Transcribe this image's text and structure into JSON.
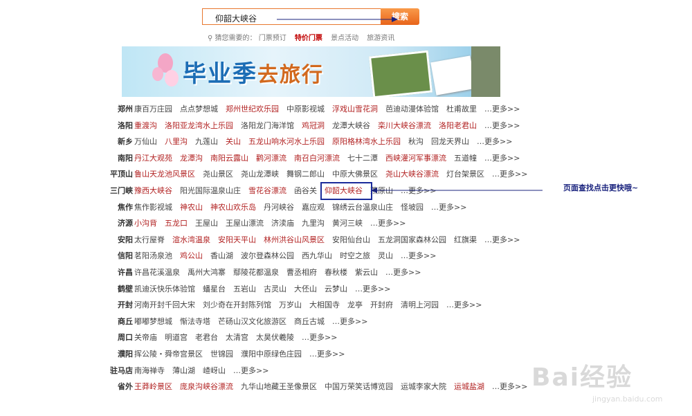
{
  "search": {
    "value": "仰韶大峡谷",
    "button_label": "搜索"
  },
  "hints": {
    "label": "猜您需要的：",
    "items": [
      "门票预订",
      "特价门票",
      "景点活动",
      "旅游资讯"
    ]
  },
  "banner": {
    "title": "毕业季",
    "subtitle": "去旅行"
  },
  "rows": [
    {
      "city": "郑州",
      "links": [
        {
          "t": "康百万庄园",
          "h": false
        },
        {
          "t": "点点梦想城",
          "h": false
        },
        {
          "t": "郑州世纪欢乐园",
          "h": true
        },
        {
          "t": "中原影视城",
          "h": false
        },
        {
          "t": "浮戏山雪花洞",
          "h": true
        },
        {
          "t": "芭迪动漫体验馆",
          "h": false
        },
        {
          "t": "杜甫故里",
          "h": false
        },
        {
          "t": "…更多>>",
          "h": false
        }
      ]
    },
    {
      "city": "洛阳",
      "links": [
        {
          "t": "重渡沟",
          "h": true
        },
        {
          "t": "洛阳亚龙湾水上乐园",
          "h": true
        },
        {
          "t": "洛阳龙门海洋馆",
          "h": false
        },
        {
          "t": "鸡冠洞",
          "h": true
        },
        {
          "t": "龙潭大峡谷",
          "h": false
        },
        {
          "t": "栾川大峡谷漂流",
          "h": true
        },
        {
          "t": "洛阳老君山",
          "h": true
        },
        {
          "t": "…更多>>",
          "h": false
        }
      ]
    },
    {
      "city": "新乡",
      "links": [
        {
          "t": "万仙山",
          "h": false
        },
        {
          "t": "八里沟",
          "h": true
        },
        {
          "t": "九莲山",
          "h": false
        },
        {
          "t": "关山",
          "h": true
        },
        {
          "t": "五龙山响水河水上乐园",
          "h": true
        },
        {
          "t": "原阳格林湾水上乐园",
          "h": true
        },
        {
          "t": "秋沟",
          "h": false
        },
        {
          "t": "回龙天界山",
          "h": false
        },
        {
          "t": "…更多>>",
          "h": false
        }
      ]
    },
    {
      "city": "南阳",
      "links": [
        {
          "t": "丹江大观苑",
          "h": true
        },
        {
          "t": "龙潭沟",
          "h": true
        },
        {
          "t": "南阳云露山",
          "h": true
        },
        {
          "t": "鹳河漂流",
          "h": true
        },
        {
          "t": "南召白河漂流",
          "h": true
        },
        {
          "t": "七十二潭",
          "h": false
        },
        {
          "t": "西峡灌河军事漂流",
          "h": true
        },
        {
          "t": "五道幢",
          "h": false
        },
        {
          "t": "…更多>>",
          "h": false
        }
      ]
    },
    {
      "city": "平顶山",
      "links": [
        {
          "t": "鲁山天龙池风景区",
          "h": true
        },
        {
          "t": "尧山景区",
          "h": false
        },
        {
          "t": "尧山龙潭峡",
          "h": false
        },
        {
          "t": "舞钢二郎山",
          "h": false
        },
        {
          "t": "中原大佛景区",
          "h": false
        },
        {
          "t": "尧山大峡谷漂流",
          "h": true
        },
        {
          "t": "灯台架景区",
          "h": false
        },
        {
          "t": "…更多>>",
          "h": false
        }
      ]
    },
    {
      "city": "三门峡",
      "links": [
        {
          "t": "豫西大峡谷",
          "h": true
        },
        {
          "t": "阳光国际温泉山庄",
          "h": false
        },
        {
          "t": "雪花谷漂流",
          "h": true
        },
        {
          "t": "函谷关",
          "h": false
        },
        {
          "t": "仰韶大峡谷",
          "h": true
        },
        {
          "t": "燕原山",
          "h": false
        },
        {
          "t": "…更多>>",
          "h": false
        }
      ]
    },
    {
      "city": "焦作",
      "links": [
        {
          "t": "焦作影视城",
          "h": false
        },
        {
          "t": "神农山",
          "h": true
        },
        {
          "t": "神农山欢乐岛",
          "h": true
        },
        {
          "t": "丹河峡谷",
          "h": false
        },
        {
          "t": "嘉应观",
          "h": false
        },
        {
          "t": "锦绣云台温泉山庄",
          "h": false
        },
        {
          "t": "怪坡园",
          "h": false
        },
        {
          "t": "…更多>>",
          "h": false
        }
      ]
    },
    {
      "city": "济源",
      "links": [
        {
          "t": "小沟背",
          "h": true
        },
        {
          "t": "五龙口",
          "h": true
        },
        {
          "t": "王屋山",
          "h": false
        },
        {
          "t": "王屋山漂流",
          "h": false
        },
        {
          "t": "济渎庙",
          "h": false
        },
        {
          "t": "九里沟",
          "h": false
        },
        {
          "t": "黄河三峡",
          "h": false
        },
        {
          "t": "…更多>>",
          "h": false
        }
      ]
    },
    {
      "city": "安阳",
      "links": [
        {
          "t": "太行屋脊",
          "h": false
        },
        {
          "t": "渲水湾温泉",
          "h": true
        },
        {
          "t": "安阳天平山",
          "h": true
        },
        {
          "t": "林州洪谷山风景区",
          "h": true
        },
        {
          "t": "安阳仙台山",
          "h": false
        },
        {
          "t": "五龙洞国家森林公园",
          "h": false
        },
        {
          "t": "红旗渠",
          "h": false
        },
        {
          "t": "…更多>>",
          "h": false
        }
      ]
    },
    {
      "city": "信阳",
      "links": [
        {
          "t": "茗阳汤泉池",
          "h": false
        },
        {
          "t": "鸡公山",
          "h": true
        },
        {
          "t": "香山湖",
          "h": false
        },
        {
          "t": "波尔登森林公园",
          "h": false
        },
        {
          "t": "西九华山",
          "h": false
        },
        {
          "t": "时空之旅",
          "h": false
        },
        {
          "t": "灵山",
          "h": false
        },
        {
          "t": "…更多>>",
          "h": false
        }
      ]
    },
    {
      "city": "许昌",
      "links": [
        {
          "t": "许昌花溪温泉",
          "h": false
        },
        {
          "t": "禹州大鸿寨",
          "h": false
        },
        {
          "t": "鄢陵花都温泉",
          "h": false
        },
        {
          "t": "曹丞相府",
          "h": false
        },
        {
          "t": "春秋楼",
          "h": false
        },
        {
          "t": "紫云山",
          "h": false
        },
        {
          "t": "…更多>>",
          "h": false
        }
      ]
    },
    {
      "city": "鹤壁",
      "links": [
        {
          "t": "凯迪沃快乐体验馆",
          "h": false
        },
        {
          "t": "蟠星台",
          "h": false
        },
        {
          "t": "五岩山",
          "h": false
        },
        {
          "t": "古灵山",
          "h": false
        },
        {
          "t": "大伾山",
          "h": false
        },
        {
          "t": "云梦山",
          "h": false
        },
        {
          "t": "…更多>>",
          "h": false
        }
      ]
    },
    {
      "city": "开封",
      "links": [
        {
          "t": "河南开封千回大宋",
          "h": false
        },
        {
          "t": "刘少奇在开封陈列馆",
          "h": false
        },
        {
          "t": "万岁山",
          "h": false
        },
        {
          "t": "大相国寺",
          "h": false
        },
        {
          "t": "龙亭",
          "h": false
        },
        {
          "t": "开封府",
          "h": false
        },
        {
          "t": "清明上河园",
          "h": false
        },
        {
          "t": "…更多>>",
          "h": false
        }
      ]
    },
    {
      "city": "商丘",
      "links": [
        {
          "t": "嘟嘟梦想城",
          "h": false
        },
        {
          "t": "惭法寺塔",
          "h": false
        },
        {
          "t": "芒砀山汉文化旅游区",
          "h": false
        },
        {
          "t": "商丘古城",
          "h": false
        },
        {
          "t": "…更多>>",
          "h": false
        }
      ]
    },
    {
      "city": "周口",
      "links": [
        {
          "t": "关帝庙",
          "h": false
        },
        {
          "t": "明道宫",
          "h": false
        },
        {
          "t": "老君台",
          "h": false
        },
        {
          "t": "太清宫",
          "h": false
        },
        {
          "t": "太昊伏羲陵",
          "h": false
        },
        {
          "t": "…更多>>",
          "h": false
        }
      ]
    },
    {
      "city": "濮阳",
      "links": [
        {
          "t": "挥公陵・舜帝宫景区",
          "h": false
        },
        {
          "t": "世锦园",
          "h": false
        },
        {
          "t": "濮阳中原绿色庄园",
          "h": false
        },
        {
          "t": "…更多>>",
          "h": false
        }
      ]
    },
    {
      "city": "驻马店",
      "links": [
        {
          "t": "南海禅寺",
          "h": false
        },
        {
          "t": "薄山湖",
          "h": false
        },
        {
          "t": "嵖岈山",
          "h": false
        },
        {
          "t": "…更多>>",
          "h": false
        }
      ]
    },
    {
      "city": "省外",
      "links": [
        {
          "t": "王莽岭景区",
          "h": true
        },
        {
          "t": "庞泉沟峡谷漂流",
          "h": true
        },
        {
          "t": "九华山地藏王圣像景区",
          "h": false
        },
        {
          "t": "中国万荣笑话博览园",
          "h": false
        },
        {
          "t": "运城李家大院",
          "h": false
        },
        {
          "t": "运城盐湖",
          "h": true
        },
        {
          "t": "…更多>>",
          "h": false
        }
      ]
    }
  ],
  "annotation": "页面查找点击更快哦~",
  "watermark": {
    "brand": "Bai经验",
    "url": "jingyan.baidu.com"
  },
  "colors": {
    "highlight": "#b22222",
    "accent": "#e8772e",
    "annotation": "#1a237e"
  }
}
